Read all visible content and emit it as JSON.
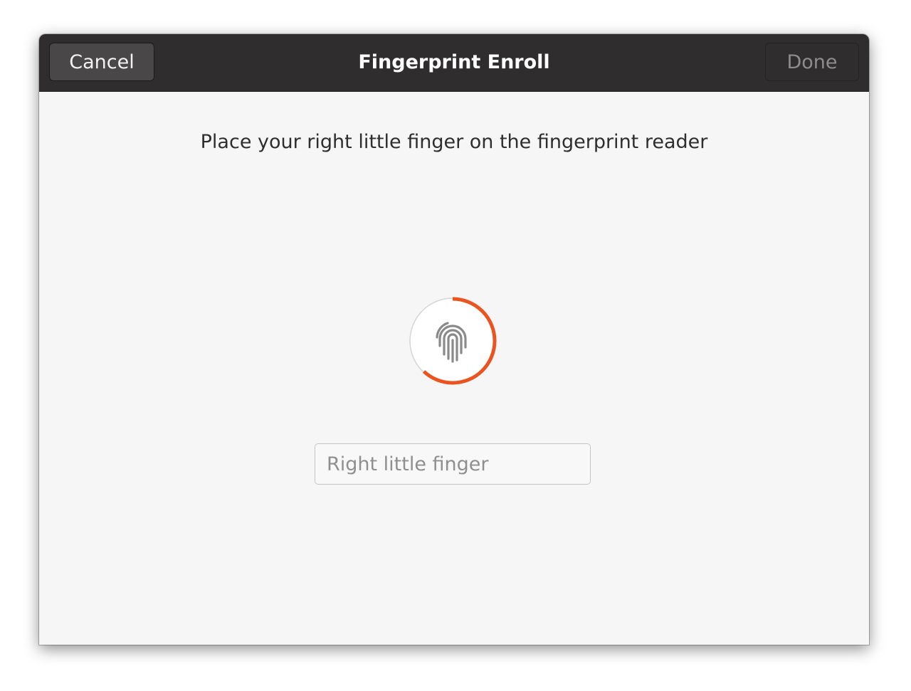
{
  "window": {
    "title": "Fingerprint Enroll"
  },
  "headerbar": {
    "cancel_label": "Cancel",
    "done_label": "Done"
  },
  "content": {
    "instruction": "Place your right little finger on the fingerprint reader",
    "enroll_progress": 0.62,
    "progress_color": "#e95420",
    "name_field": {
      "value": "",
      "placeholder": "Right little finger"
    }
  },
  "icons": {
    "indicator": "fingerprint-icon"
  }
}
